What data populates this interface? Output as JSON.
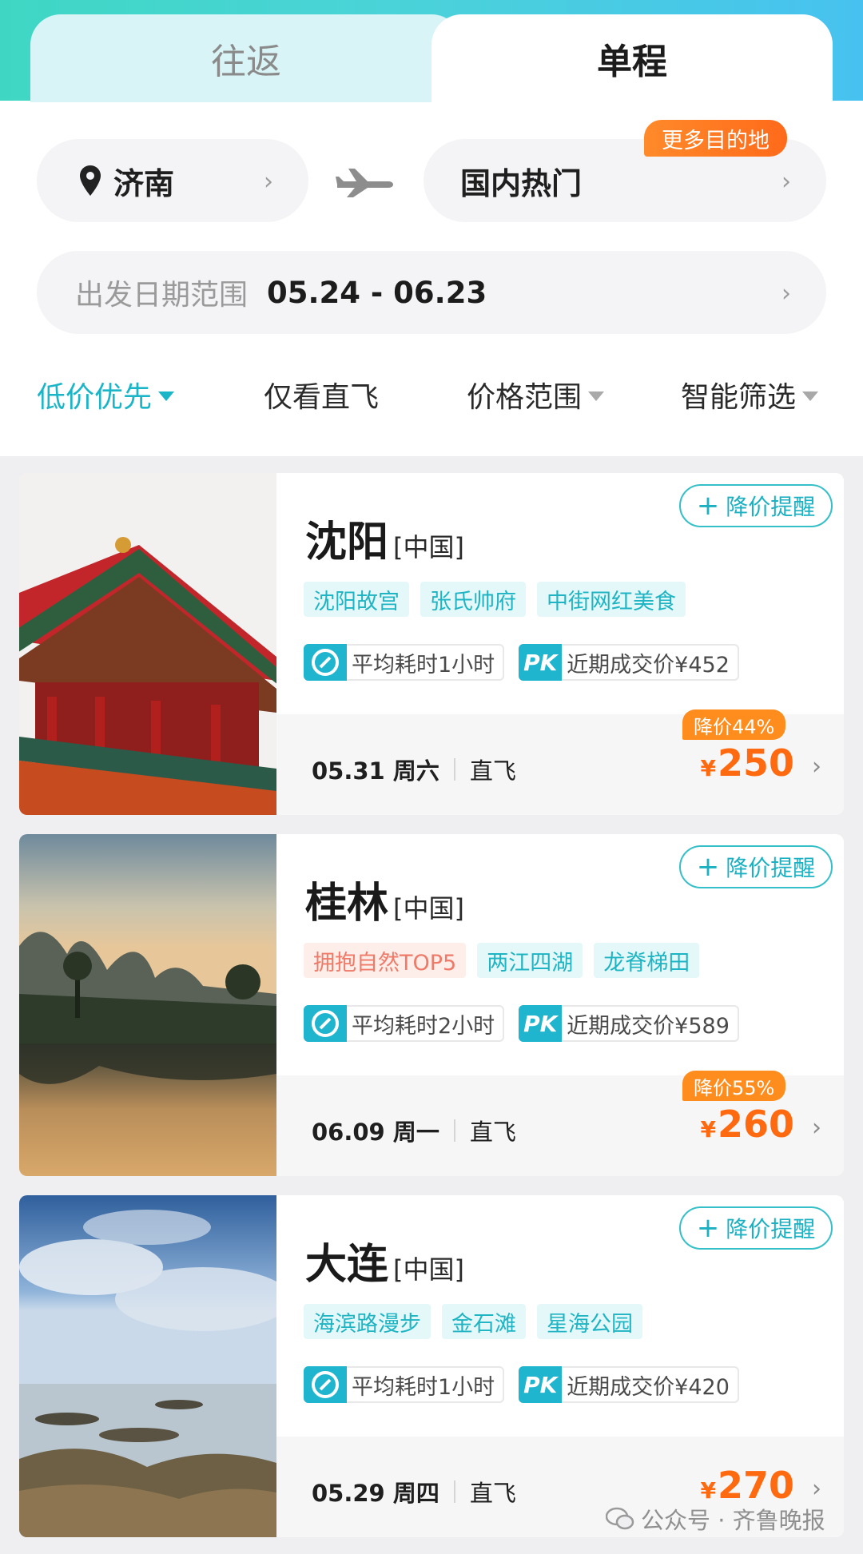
{
  "tabs": {
    "round_trip": "往返",
    "one_way": "单程"
  },
  "search": {
    "from_city": "济南",
    "to_city": "国内热门",
    "more_destinations": "更多目的地",
    "date_label": "出发日期范围",
    "date_value": "05.24 - 06.23"
  },
  "filters": {
    "low_price": "低价优先",
    "direct_only": "仅看直飞",
    "price_range": "价格范围",
    "smart_filter": "智能筛选"
  },
  "cards": [
    {
      "city": "沈阳",
      "country": "[中国]",
      "remind": "降价提醒",
      "tags": [
        "沈阳故宫",
        "张氏帅府",
        "中街网红美食"
      ],
      "avg_time": "平均耗时1小时",
      "recent_price": "近期成交价¥452",
      "date": "05.31 周六",
      "flight_type": "直飞",
      "discount": "降价44%",
      "currency": "¥",
      "price": "250"
    },
    {
      "city": "桂林",
      "country": "[中国]",
      "remind": "降价提醒",
      "tags": [
        "拥抱自然TOP5",
        "两江四湖",
        "龙脊梯田"
      ],
      "avg_time": "平均耗时2小时",
      "recent_price": "近期成交价¥589",
      "date": "06.09 周一",
      "flight_type": "直飞",
      "discount": "降价55%",
      "currency": "¥",
      "price": "260"
    },
    {
      "city": "大连",
      "country": "[中国]",
      "remind": "降价提醒",
      "tags": [
        "海滨路漫步",
        "金石滩",
        "星海公园"
      ],
      "avg_time": "平均耗时1小时",
      "recent_price": "近期成交价¥420",
      "date": "05.29 周四",
      "flight_type": "直飞",
      "currency": "¥",
      "price": "270"
    }
  ],
  "pk_label": "PK",
  "watermark": "公众号 · 齐鲁晚报",
  "colors": {
    "accent": "#1bb5c8",
    "price": "#ff6a10",
    "discount": "#ff8d1e"
  }
}
